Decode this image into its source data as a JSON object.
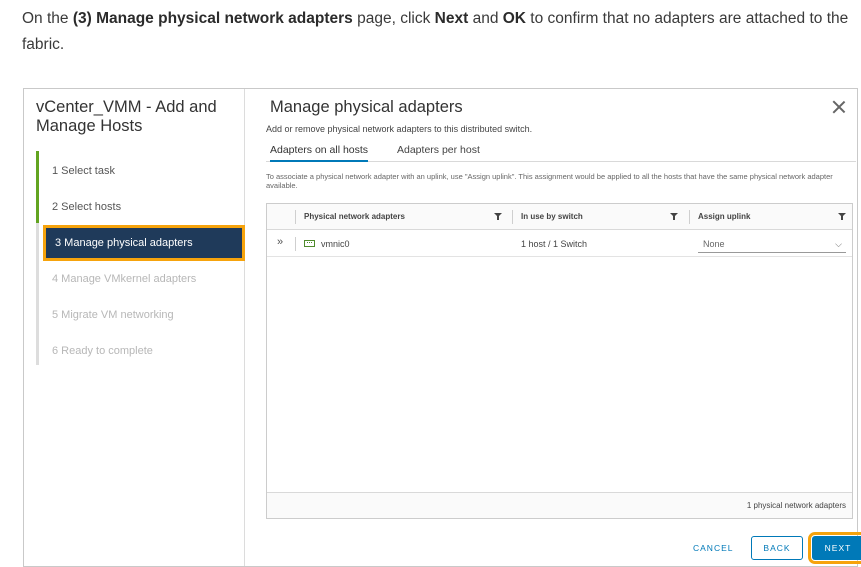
{
  "instruction": {
    "p1": "On the ",
    "b1": "(3) Manage physical network adapters",
    "p2": " page, click ",
    "b2": "Next",
    "p3": " and ",
    "b3": "OK",
    "p4": " to confirm that no adapters are attached to the fabric."
  },
  "wizard": {
    "title": "vCenter_VMM - Add and Manage Hosts",
    "steps": [
      {
        "label": "1  Select task",
        "state": "completed"
      },
      {
        "label": "2  Select hosts",
        "state": "completed"
      },
      {
        "label": "3  Manage physical adapters",
        "state": "active"
      },
      {
        "label": "4  Manage VMkernel adapters",
        "state": "disabled"
      },
      {
        "label": "5  Migrate VM networking",
        "state": "disabled"
      },
      {
        "label": "6  Ready to complete",
        "state": "disabled"
      }
    ]
  },
  "main": {
    "title": "Manage physical adapters",
    "subtitle": "Add or remove physical network adapters to this distributed switch.",
    "tabs": [
      {
        "label": "Adapters on all hosts",
        "active": true
      },
      {
        "label": "Adapters per host",
        "active": false
      }
    ],
    "note": "To associate a physical network adapter with an uplink, use \"Assign uplink\". This assignment would be applied to all the hosts that have the same physical network adapter available.",
    "columns": [
      "Physical network adapters",
      "In use by switch",
      "Assign uplink"
    ],
    "rows": [
      {
        "adapter": "vmnic0",
        "in_use": "1 host / 1 Switch",
        "uplink": "None"
      }
    ],
    "footer": "1 physical network adapters"
  },
  "buttons": {
    "cancel": "CANCEL",
    "back": "BACK",
    "next": "NEXT"
  },
  "icons": [
    "close-icon",
    "filter-icon",
    "expand-icon",
    "network-adapter-icon",
    "chevron-down-icon"
  ],
  "colors": {
    "accent": "#0079b8",
    "active_step_bg": "#1f3a5a",
    "highlight": "#f6a30c",
    "progress": "#62a420"
  }
}
